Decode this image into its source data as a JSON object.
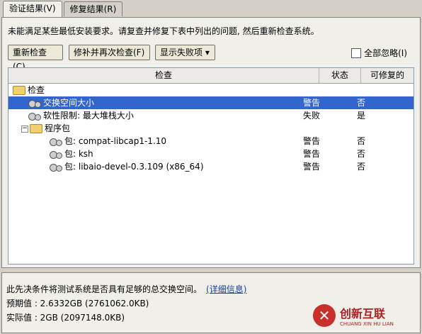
{
  "tabs": [
    "验证结果(V)",
    "修复结果(R)"
  ],
  "info_text": "未能满足某些最低安装要求。请复查并修复下表中列出的问题, 然后重新检查系统。",
  "buttons": {
    "recheck": "重新检查(C)",
    "fix_recheck": "修补并再次检查(F)",
    "show_failed": "显示失败项 ▾"
  },
  "ignore_all": "全部忽略(I)",
  "table": {
    "headers": [
      "检查",
      "状态",
      "可修复的"
    ],
    "rows": [
      {
        "name": "检查",
        "status": "",
        "fixable": ""
      },
      {
        "name": "交换空间大小",
        "status": "警告",
        "fixable": "否"
      },
      {
        "name": "软性限制: 最大堆栈大小",
        "status": "失败",
        "fixable": "是"
      },
      {
        "name": "程序包",
        "status": "",
        "fixable": ""
      },
      {
        "name": "包: compat-libcap1-1.10",
        "status": "警告",
        "fixable": "否"
      },
      {
        "name": "包: ksh",
        "status": "警告",
        "fixable": "否"
      },
      {
        "name": "包: libaio-devel-0.3.109 (x86_64)",
        "status": "警告",
        "fixable": "否"
      }
    ]
  },
  "details": {
    "description": "此先决条件将测试系统是否具有足够的总交换空间。",
    "link": "(详细信息)",
    "expected": "预期值 : 2.6332GB (2761062.0KB)",
    "actual": "实际值 : 2GB (2097148.0KB)"
  },
  "watermark": {
    "name": "创新互联",
    "sub": "CHUANG XIN HU LIAN"
  }
}
